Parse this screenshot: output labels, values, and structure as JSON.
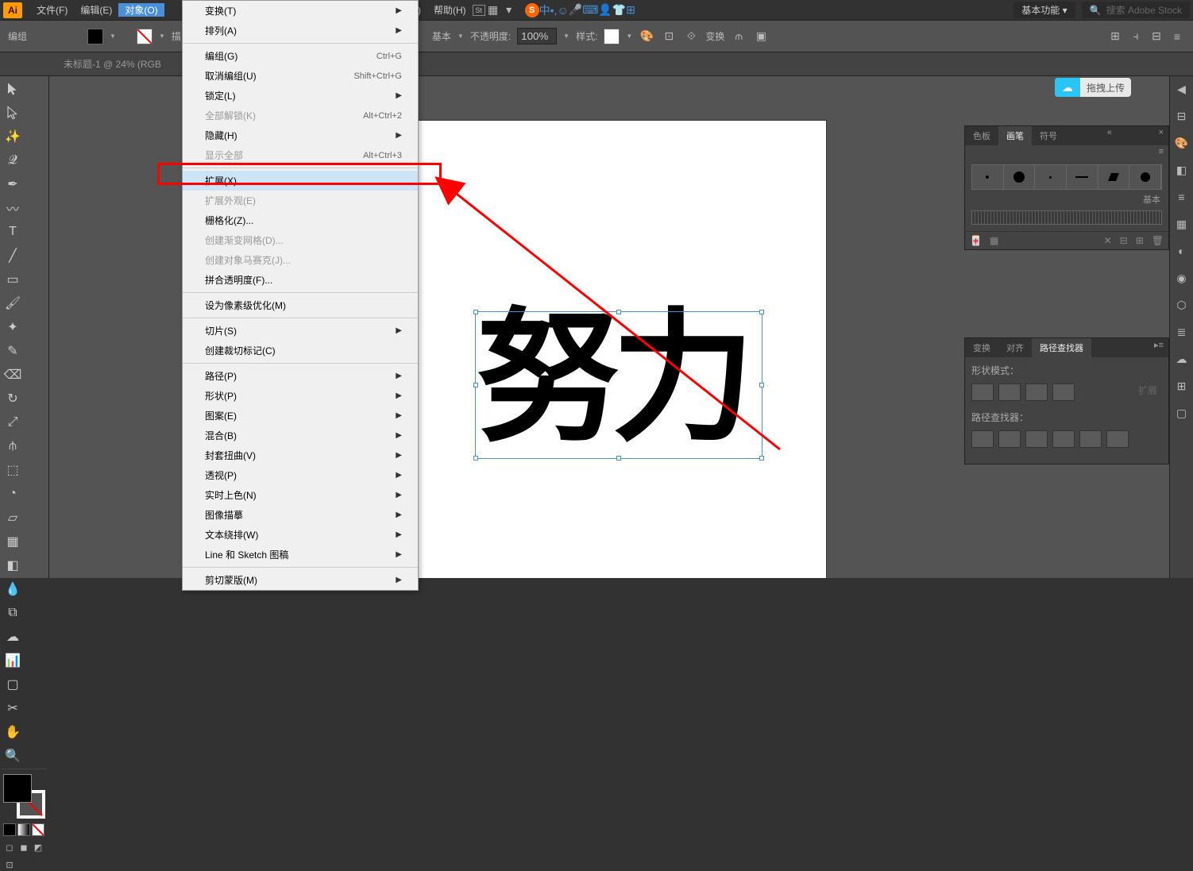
{
  "app": {
    "logo": "Ai"
  },
  "menubar": {
    "file": "文件(F)",
    "edit": "编辑(E)",
    "object": "对象(O)",
    "window": "W)",
    "help": "帮助(H)",
    "workspace": "基本功能 ▾",
    "search_placeholder": "搜索 Adobe Stock"
  },
  "tray": {
    "zhong": "中"
  },
  "controlbar": {
    "group": "编组",
    "stroke": "描",
    "basic": "基本",
    "opacity_label": "不透明度:",
    "opacity_value": "100%",
    "style_label": "样式:",
    "transform": "变换"
  },
  "doctab": "未标题-1 @ 24% (RGB",
  "upload": "拖拽上传",
  "canvas_text": "努力",
  "panels": {
    "brush": {
      "tabs": {
        "swatches": "色板",
        "brushes": "画笔",
        "symbols": "符号"
      },
      "basic_label": "基本"
    },
    "pathfinder": {
      "tabs": {
        "transform": "变换",
        "align": "对齐",
        "pathfinder": "路径查找器"
      },
      "shape_mode_label": "形状模式：",
      "pathfinder_label": "路径查找器：",
      "expand_label": "扩展"
    }
  },
  "dropdown": {
    "items": [
      {
        "label": "变换(T)",
        "sub": true
      },
      {
        "label": "排列(A)",
        "sub": true
      },
      {
        "sep": true
      },
      {
        "label": "编组(G)",
        "shortcut": "Ctrl+G"
      },
      {
        "label": "取消编组(U)",
        "shortcut": "Shift+Ctrl+G"
      },
      {
        "label": "锁定(L)",
        "sub": true
      },
      {
        "label": "全部解锁(K)",
        "shortcut": "Alt+Ctrl+2",
        "disabled": true
      },
      {
        "label": "隐藏(H)",
        "sub": true
      },
      {
        "label": "显示全部",
        "shortcut": "Alt+Ctrl+3",
        "disabled": true
      },
      {
        "sep": true
      },
      {
        "label": "扩展(X)...",
        "highlighted": true
      },
      {
        "label": "扩展外观(E)",
        "disabled": true
      },
      {
        "label": "栅格化(Z)..."
      },
      {
        "label": "创建渐变网格(D)...",
        "disabled": true
      },
      {
        "label": "创建对象马赛克(J)...",
        "disabled": true
      },
      {
        "label": "拼合透明度(F)..."
      },
      {
        "sep": true
      },
      {
        "label": "设为像素级优化(M)"
      },
      {
        "sep": true
      },
      {
        "label": "切片(S)",
        "sub": true
      },
      {
        "label": "创建裁切标记(C)"
      },
      {
        "sep": true
      },
      {
        "label": "路径(P)",
        "sub": true
      },
      {
        "label": "形状(P)",
        "sub": true
      },
      {
        "label": "图案(E)",
        "sub": true
      },
      {
        "label": "混合(B)",
        "sub": true
      },
      {
        "label": "封套扭曲(V)",
        "sub": true
      },
      {
        "label": "透视(P)",
        "sub": true
      },
      {
        "label": "实时上色(N)",
        "sub": true
      },
      {
        "label": "图像描摹",
        "sub": true
      },
      {
        "label": "文本绕排(W)",
        "sub": true
      },
      {
        "label": "Line 和 Sketch 图稿",
        "sub": true
      },
      {
        "sep": true
      },
      {
        "label": "剪切蒙版(M)",
        "sub": true
      }
    ]
  }
}
